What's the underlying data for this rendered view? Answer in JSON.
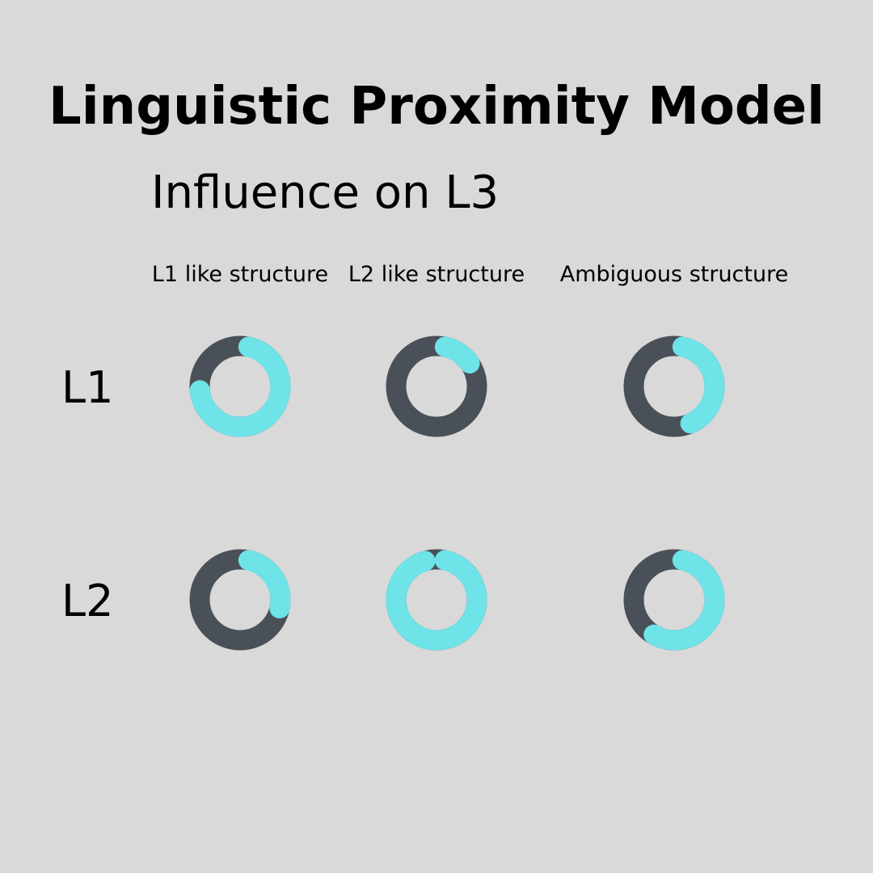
{
  "title": "Linguistic Proximity Model",
  "subtitle": "Influence on L3",
  "colors": {
    "background": "#d9d9d9",
    "track": "#4a5058",
    "fill": "#6ee3e8",
    "text": "#000000"
  },
  "chart_data": {
    "type": "donut-grid",
    "columns": [
      "L1 like structure",
      "L2 like structure",
      "Ambiguous structure"
    ],
    "rows": [
      "L1",
      "L2"
    ],
    "unit": "fraction of ring filled (estimated)",
    "values": [
      [
        0.7,
        0.12,
        0.4
      ],
      [
        0.25,
        0.92,
        0.55
      ]
    ]
  }
}
